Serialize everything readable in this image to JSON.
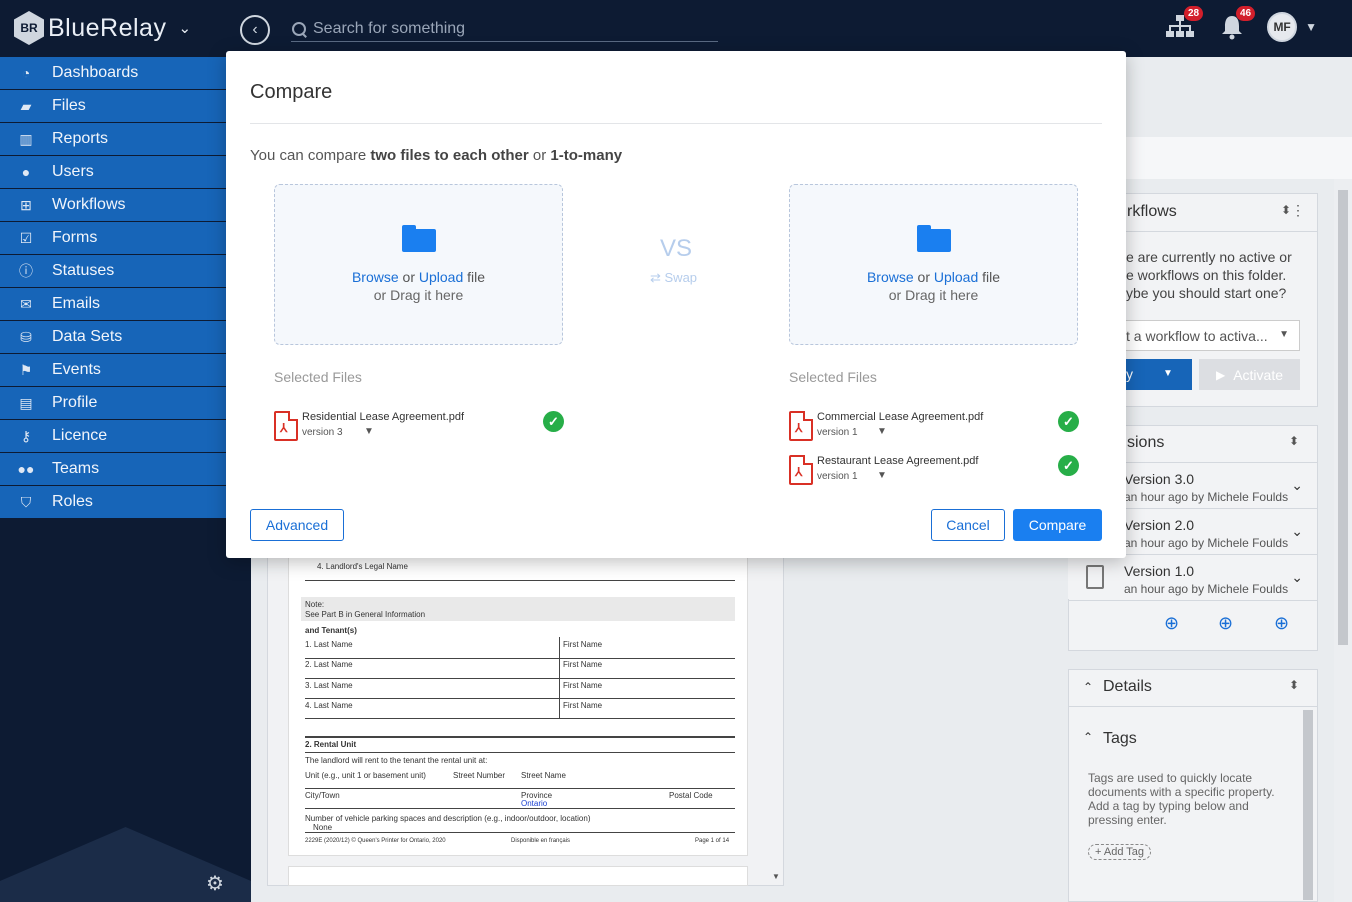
{
  "app": {
    "name": "BlueRelay",
    "logo_initials": "BR"
  },
  "topbar": {
    "search_placeholder": "Search for something",
    "workflow_badge": "28",
    "notifications_badge": "46",
    "avatar_initials": "MF"
  },
  "sidebar": {
    "items": [
      {
        "label": "Dashboards",
        "icon": "dashboard-icon"
      },
      {
        "label": "Files",
        "icon": "folder-icon"
      },
      {
        "label": "Reports",
        "icon": "bar-chart-icon"
      },
      {
        "label": "Users",
        "icon": "user-icon"
      },
      {
        "label": "Workflows",
        "icon": "sitemap-icon"
      },
      {
        "label": "Forms",
        "icon": "checkbox-icon"
      },
      {
        "label": "Statuses",
        "icon": "info-icon"
      },
      {
        "label": "Emails",
        "icon": "envelope-icon"
      },
      {
        "label": "Data Sets",
        "icon": "database-icon"
      },
      {
        "label": "Events",
        "icon": "flag-icon"
      },
      {
        "label": "Profile",
        "icon": "id-card-icon"
      },
      {
        "label": "Licence",
        "icon": "key-icon"
      },
      {
        "label": "Teams",
        "icon": "users-icon"
      },
      {
        "label": "Roles",
        "icon": "shield-icon"
      }
    ]
  },
  "modal": {
    "title": "Compare",
    "desc_prefix": "You can compare ",
    "desc_bold1": "two files to each other",
    "desc_mid": " or ",
    "desc_bold2": "1-to-many",
    "dropzone": {
      "browse": "Browse",
      "or": " or ",
      "upload": "Upload",
      "file": " file",
      "drag": "or Drag it here"
    },
    "vs": "VS",
    "swap": "⇄ Swap",
    "selected_label": "Selected Files",
    "left_files": [
      {
        "name": "Residential Lease Agreement.pdf",
        "version": "version 3"
      }
    ],
    "right_files": [
      {
        "name": "Commercial Lease Agreement.pdf",
        "version": "version 1"
      },
      {
        "name": "Restaurant Lease Agreement.pdf",
        "version": "version 1"
      }
    ],
    "advanced_label": "Advanced",
    "cancel_label": "Cancel",
    "compare_label": "Compare"
  },
  "right_panel": {
    "workflows_title": "rkflows",
    "workflows_text": [
      "e are currently no active or",
      "e workflows on this folder.",
      "ybe you should start one?"
    ],
    "workflow_select": "t a workflow to activa...",
    "workflow_btn": "y",
    "activate_label": "Activate",
    "versions_title": "sions",
    "versions": [
      {
        "name": "Version 3.0",
        "meta": "an hour ago by Michele Foulds"
      },
      {
        "name": "Version 2.0",
        "meta": "an hour ago by Michele Foulds"
      },
      {
        "name": "Version 1.0",
        "meta": "an hour ago by Michele Foulds"
      }
    ],
    "details_title": "Details",
    "tags_title": "Tags",
    "tags_text": "Tags are used to quickly locate documents with a specific property. Add a tag by typing below and pressing enter.",
    "add_tag": "+ Add Tag"
  },
  "document": {
    "lines": [
      "4.   Landlord's Legal Name",
      "Note:",
      "See Part B in General Information",
      "and Tenant(s)",
      "1.   Last Name",
      "2.   Last Name",
      "3.   Last Name",
      "4.   Last Name",
      "First Name",
      "2. Rental Unit",
      "The landlord will rent to the tenant the rental unit at:",
      "Unit  (e.g., unit 1 or basement unit)",
      "Street Number",
      "Street Name",
      "City/Town",
      "Province",
      "Ontario",
      "Postal Code",
      "Number of vehicle parking spaces and description (e.g., indoor/outdoor, location)",
      "None",
      "2229E (2020/12)    © Queen's Printer for Ontario, 2020",
      "Disponible en français",
      "Page 1 of 14"
    ]
  }
}
